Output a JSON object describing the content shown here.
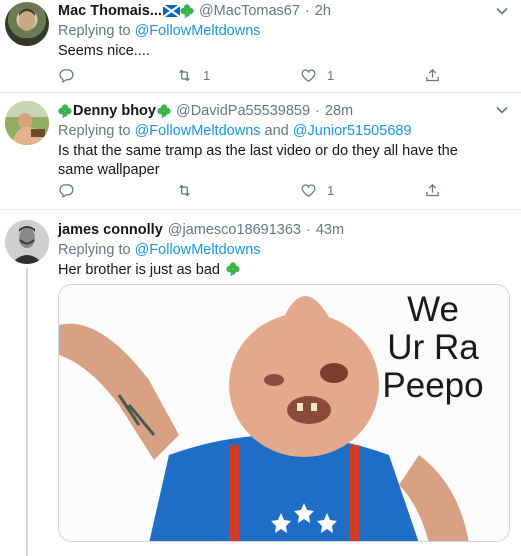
{
  "tweets": [
    {
      "name": "Mac Thomais...",
      "handle": "@MacTomas67",
      "sep": "·",
      "time": "2h",
      "reply_prefix": "Replying to",
      "reply_users": [
        "@FollowMeltdowns"
      ],
      "text": "Seems nice....",
      "replies": "",
      "retweets": "1",
      "likes": "1"
    },
    {
      "name": "Denny bhoy",
      "handle": "@DavidPa55539859",
      "sep": "·",
      "time": "28m",
      "reply_prefix": "Replying to",
      "reply_users": [
        "@FollowMeltdowns",
        "@Junior51505689"
      ],
      "reply_and": "and",
      "text": "Is that the same tramp as the last video or do they all have the same wallpaper",
      "replies": "",
      "retweets": "",
      "likes": "1"
    },
    {
      "name": "james connolly",
      "handle": "@jamesco18691363",
      "sep": "·",
      "time": "43m",
      "reply_prefix": "Replying to",
      "reply_users": [
        "@FollowMeltdowns"
      ],
      "text": "Her brother is just as bad",
      "media": {
        "meme_lines": [
          "We",
          "Ur Ra",
          "Peepo"
        ]
      }
    }
  ],
  "colors": {
    "link": "#1b95e0",
    "muted": "#657786",
    "border": "#e6ecf0",
    "clover": "#3bb54a",
    "saltire_blue": "#0065bd"
  },
  "icons": [
    "chevron-down-icon",
    "reply-icon",
    "retweet-icon",
    "like-icon",
    "share-icon",
    "clover-icon",
    "scotland-flag-icon"
  ]
}
